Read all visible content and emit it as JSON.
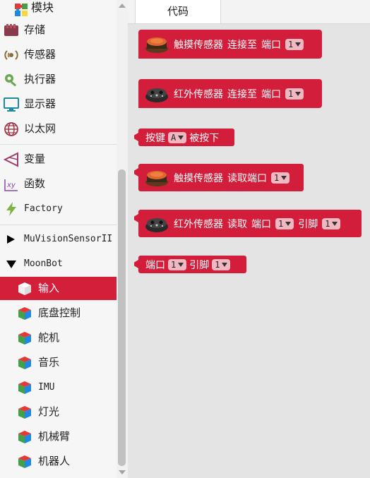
{
  "sidebar": {
    "header_label": "模块",
    "items": [
      {
        "label": "存储",
        "icon": "storage-icon"
      },
      {
        "label": "传感器",
        "icon": "sensor-icon"
      },
      {
        "label": "执行器",
        "icon": "actuator-icon"
      },
      {
        "label": "显示器",
        "icon": "display-icon"
      },
      {
        "label": "以太网",
        "icon": "ethernet-icon"
      },
      {
        "label": "变量",
        "icon": "variable-icon"
      },
      {
        "label": "函数",
        "icon": "function-icon"
      },
      {
        "label": "Factory",
        "icon": "factory-icon"
      },
      {
        "label": "MuVisionSensorII",
        "icon": "triangle-right-icon"
      },
      {
        "label": "MoonBot",
        "icon": "triangle-down-icon"
      }
    ],
    "subitems": [
      {
        "label": "输入",
        "active": true
      },
      {
        "label": "底盘控制"
      },
      {
        "label": "舵机"
      },
      {
        "label": "音乐"
      },
      {
        "label": "IMU"
      },
      {
        "label": "灯光"
      },
      {
        "label": "机械臂"
      },
      {
        "label": "机器人"
      }
    ]
  },
  "tabs": {
    "code": "代码"
  },
  "blocks": {
    "b1": {
      "sensor": "触摸传感器",
      "verb": "连接至",
      "port_label": "端口",
      "port_value": "1"
    },
    "b2": {
      "sensor": "红外传感器",
      "verb": "连接至",
      "port_label": "端口",
      "port_value": "1"
    },
    "b3": {
      "prefix": "按键",
      "key_value": "A",
      "suffix": "被按下"
    },
    "b4": {
      "sensor": "触摸传感器",
      "verb": "读取端口",
      "port_value": "1"
    },
    "b5": {
      "sensor": "红外传感器",
      "verb": "读取",
      "port_label": "端口",
      "port_value": "1",
      "pin_label": "引脚",
      "pin_value": "1"
    },
    "b6": {
      "port_label": "端口",
      "port_value": "1",
      "pin_label": "引脚",
      "pin_value": "1"
    }
  },
  "colors": {
    "accent": "#d21e3a",
    "dropdown": "#f1b8c1",
    "workspace": "#e4e4e4"
  }
}
